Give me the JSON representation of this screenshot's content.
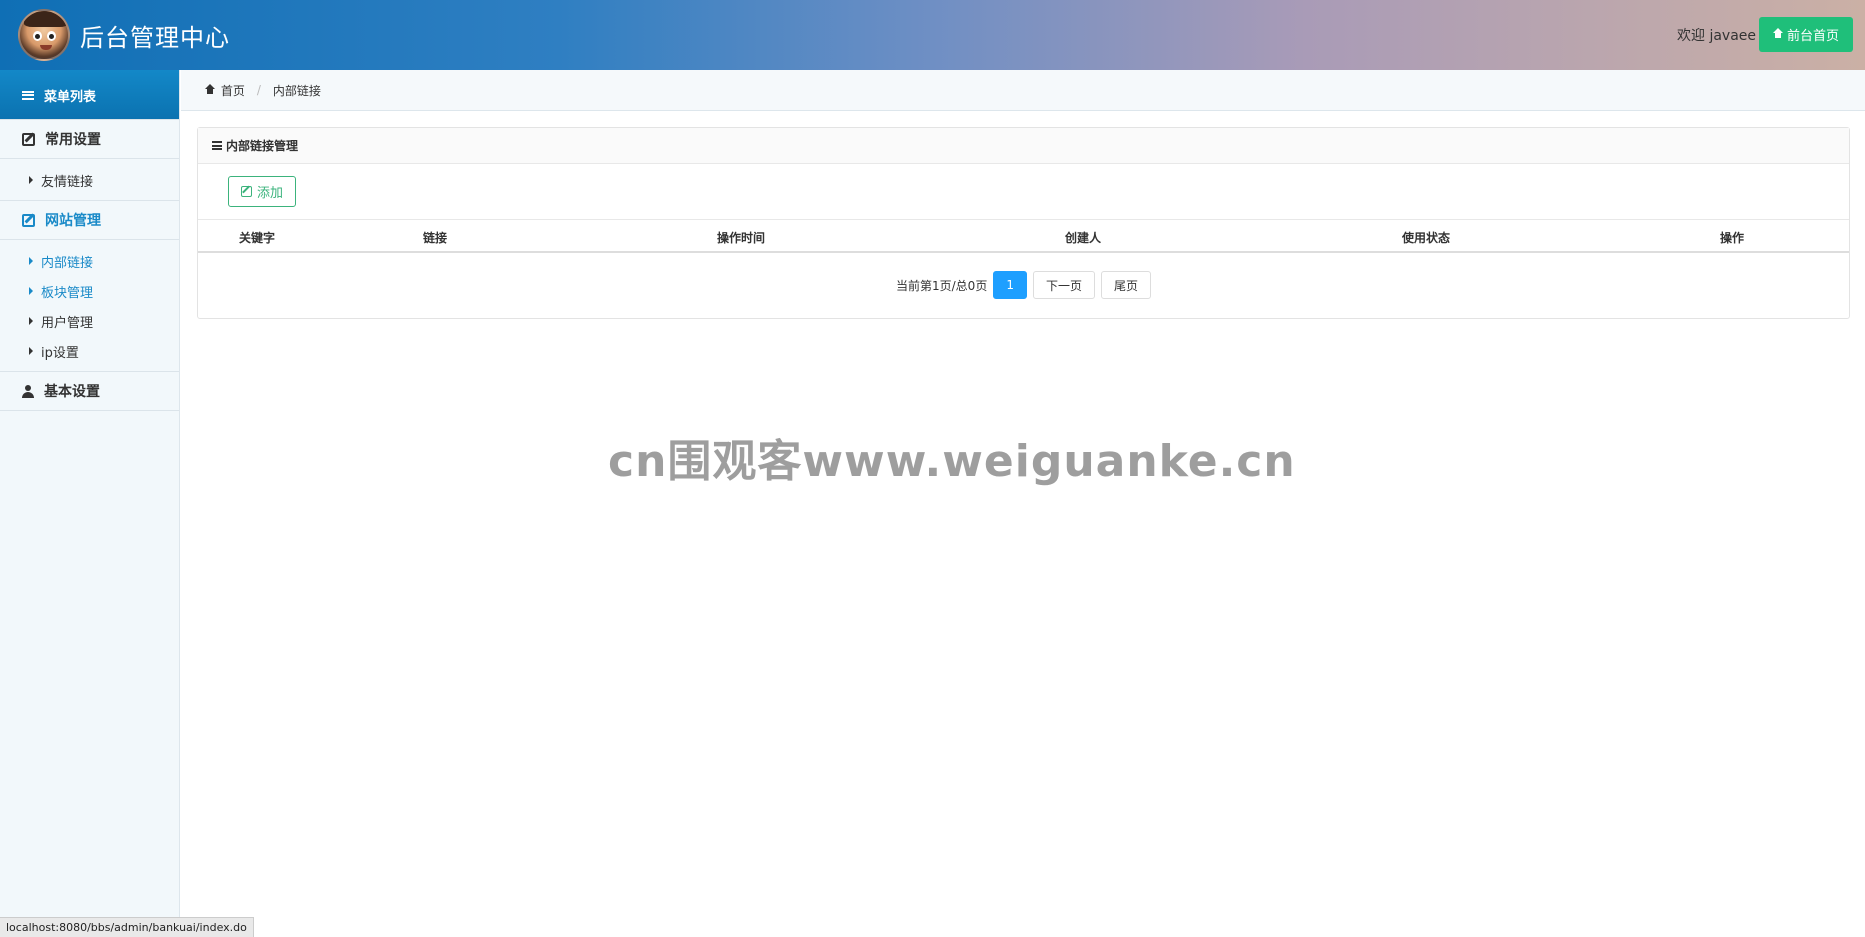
{
  "header": {
    "title": "后台管理中心",
    "welcome": "欢迎 javaee",
    "front_button": "前台首页"
  },
  "sidebar": {
    "head": "菜单列表",
    "groups": [
      {
        "label": "常用设置",
        "icon": "edit-icon",
        "items": [
          "友情链接"
        ]
      },
      {
        "label": "网站管理",
        "icon": "edit-icon",
        "items": [
          "内部链接",
          "板块管理",
          "用户管理",
          "ip设置"
        ]
      },
      {
        "label": "基本设置",
        "icon": "user-icon",
        "items": []
      }
    ]
  },
  "breadcrumb": {
    "home": "首页",
    "current": "内部链接"
  },
  "panel": {
    "title": "内部链接管理",
    "add_button": "添加",
    "columns": [
      "关键字",
      "链接",
      "操作时间",
      "创建人",
      "使用状态",
      "操作"
    ],
    "rows": []
  },
  "pager": {
    "info": "当前第1页/总0页",
    "current_page": "1",
    "next": "下一页",
    "last": "尾页"
  },
  "watermark": "cn围观客www.weiguanke.cn",
  "statusbar": "localhost:8080/bbs/admin/bankuai/index.do",
  "colors": {
    "accent": "#1a8ac8",
    "green": "#1fbf7a",
    "page_active": "#1e9fff"
  }
}
